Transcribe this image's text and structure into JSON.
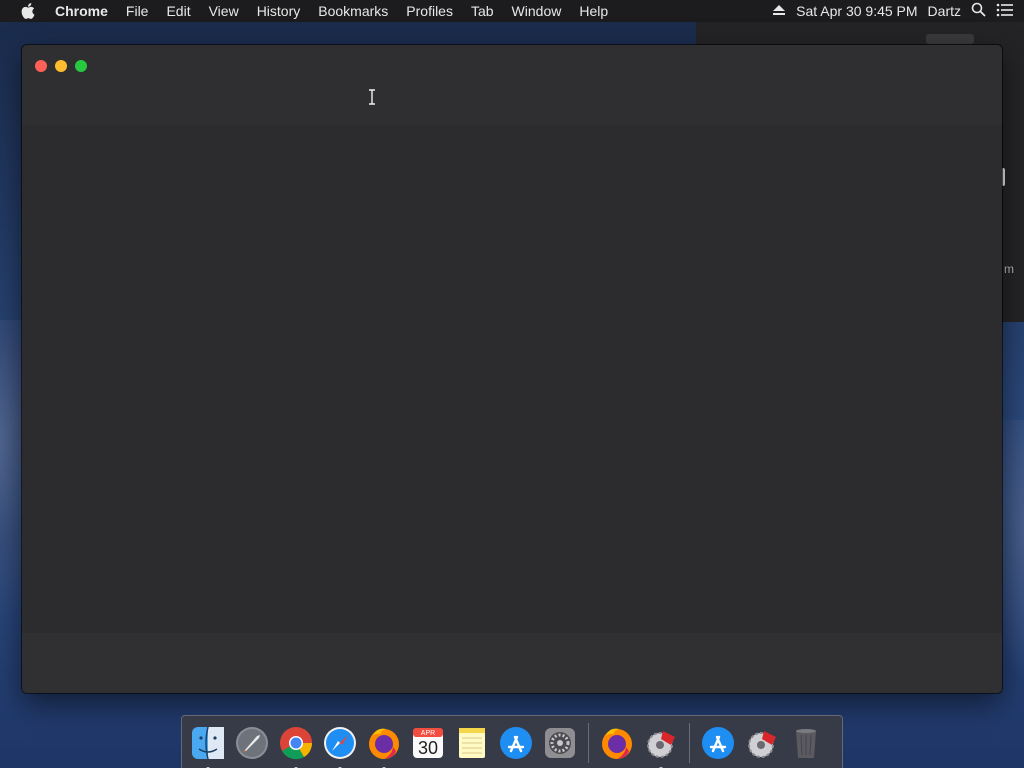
{
  "menubar": {
    "app_name": "Chrome",
    "items": [
      "File",
      "Edit",
      "View",
      "History",
      "Bookmarks",
      "Profiles",
      "Tab",
      "Window",
      "Help"
    ],
    "datetime": "Sat Apr 30  9:45 PM",
    "user": "Dartz",
    "icons": [
      "apple-icon",
      "eject-icon",
      "search-icon",
      "list-icon"
    ]
  },
  "background_window": {
    "peek_title": "",
    "peek_side_text": "m"
  },
  "main_window": {
    "title": "",
    "traffic_lights": [
      "close",
      "minimize",
      "zoom"
    ]
  },
  "dock": {
    "items": [
      {
        "name": "Finder",
        "icon": "finder-icon",
        "running": true
      },
      {
        "name": "Launchpad",
        "icon": "launchpad-icon",
        "running": false
      },
      {
        "name": "Google Chrome",
        "icon": "chrome-icon",
        "running": true
      },
      {
        "name": "Safari",
        "icon": "safari-icon",
        "running": true
      },
      {
        "name": "Firefox",
        "icon": "firefox-icon",
        "running": true
      },
      {
        "name": "Calendar",
        "icon": "calendar-icon",
        "running": false,
        "month": "APR",
        "day": "30"
      },
      {
        "name": "Notes",
        "icon": "notes-icon",
        "running": false
      },
      {
        "name": "App Store",
        "icon": "app-store-icon",
        "running": false
      },
      {
        "name": "System Preferences",
        "icon": "system-preferences-icon",
        "running": false
      },
      {
        "name": "Firefox",
        "icon": "firefox-icon",
        "running": false
      },
      {
        "name": "Installer",
        "icon": "installer-saw-icon",
        "running": true
      },
      {
        "name": "App Store",
        "icon": "app-store-icon",
        "running": false
      },
      {
        "name": "Installer",
        "icon": "installer-saw-icon",
        "running": false
      },
      {
        "name": "Trash",
        "icon": "trash-icon",
        "running": false
      }
    ],
    "colors": {
      "chrome_red": "#db4437",
      "chrome_green": "#0f9d58",
      "chrome_yellow": "#f4b400",
      "chrome_blue": "#4285f4",
      "app_store_blue": "#1e8ef2",
      "firefox_orange": "#ff8a00"
    }
  }
}
